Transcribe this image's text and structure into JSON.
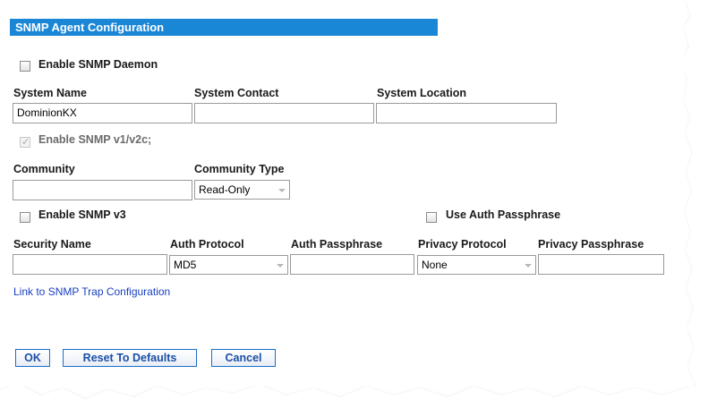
{
  "header": {
    "title": "SNMP Agent Configuration"
  },
  "daemon": {
    "label": "Enable SNMP Daemon",
    "checked": false
  },
  "system": {
    "name_label": "System Name",
    "name_value": "DominionKX",
    "contact_label": "System Contact",
    "contact_value": "",
    "location_label": "System Location",
    "location_value": ""
  },
  "v1v2c": {
    "label": "Enable SNMP v1/v2c;",
    "checked": true,
    "disabled": true
  },
  "community": {
    "label": "Community",
    "value": "",
    "type_label": "Community Type",
    "type_value": "Read-Only"
  },
  "v3": {
    "label": "Enable SNMP v3",
    "checked": false
  },
  "auth_passphrase_toggle": {
    "label": "Use Auth Passphrase",
    "checked": false
  },
  "security": {
    "security_name_label": "Security Name",
    "security_name_value": "",
    "auth_protocol_label": "Auth Protocol",
    "auth_protocol_value": "MD5",
    "auth_passphrase_label": "Auth Passphrase",
    "auth_passphrase_value": "",
    "privacy_protocol_label": "Privacy Protocol",
    "privacy_protocol_value": "None",
    "privacy_passphrase_label": "Privacy Passphrase",
    "privacy_passphrase_value": ""
  },
  "trap_link": {
    "label": "Link to SNMP Trap Configuration"
  },
  "buttons": {
    "ok": "OK",
    "reset": "Reset To Defaults",
    "cancel": "Cancel"
  },
  "colors": {
    "header_bg": "#1a86d6",
    "link": "#1a3fbf",
    "button_text": "#1b4fa8"
  }
}
